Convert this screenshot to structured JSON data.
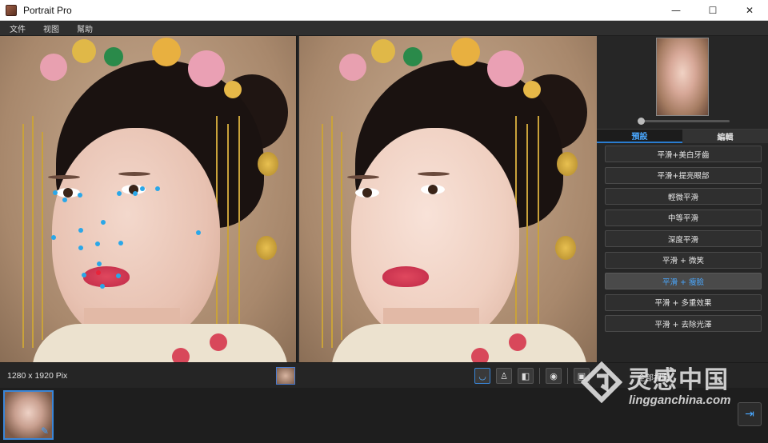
{
  "window": {
    "title": "Portrait Pro",
    "minimize": "—",
    "maximize": "☐",
    "close": "✕"
  },
  "menu": [
    {
      "label": "文件"
    },
    {
      "label": "视图"
    },
    {
      "label": "幫助"
    }
  ],
  "panel": {
    "tabs": [
      {
        "label": "預設",
        "active": true
      },
      {
        "label": "編輯",
        "active": false
      }
    ],
    "presets": [
      {
        "label": "平滑+美白牙齒",
        "selected": false
      },
      {
        "label": "平滑+提亮眼部",
        "selected": false
      },
      {
        "label": "輕微平滑",
        "selected": false
      },
      {
        "label": "中等平滑",
        "selected": false
      },
      {
        "label": "深度平滑",
        "selected": false
      },
      {
        "label": "平滑 + 微笑",
        "selected": false
      },
      {
        "label": "平滑 + 瘦臉",
        "selected": true
      },
      {
        "label": "平滑 + 多重效果",
        "selected": false
      },
      {
        "label": "平滑 + 去除光澤",
        "selected": false
      }
    ],
    "slider_value": 0.02
  },
  "statusbar": {
    "dimensions": "1280 x 1920 Pix",
    "all_views": "全部視圖"
  },
  "watermark": {
    "cn": "灵感中国",
    "en": "lingganchina.com"
  },
  "colors": {
    "accent": "#4aa8ff",
    "landmark": "#2aa7e8",
    "landmark_active": "#e8243a"
  }
}
